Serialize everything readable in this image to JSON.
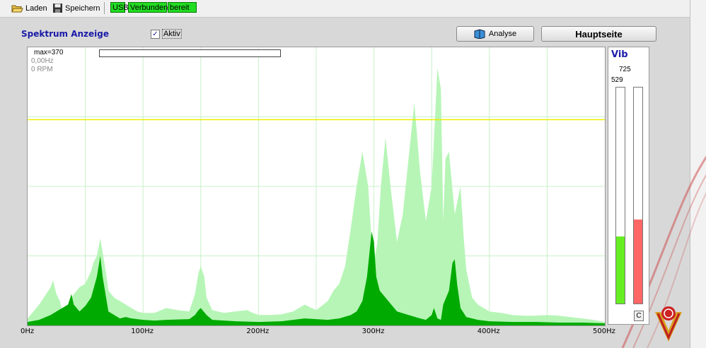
{
  "toolbar": {
    "load_label": "Laden",
    "save_label": "Speichern",
    "status": [
      "USB",
      "Verbunden",
      "bereit"
    ]
  },
  "spectrum": {
    "title": "Spektrum Anzeige",
    "active_label": "Aktiv",
    "active_checked": true,
    "max_label": "max=370",
    "freq_readout": "0,00Hz",
    "rpm_readout": "0 RPM"
  },
  "buttons": {
    "analyse_label": "Analyse",
    "home_label": "Hauptseite"
  },
  "vib": {
    "title": "Vib",
    "value_right": "725",
    "value_left": "529",
    "left_level": 0.31,
    "right_level": 0.39,
    "left_color": "#66ee22",
    "right_color": "#ff6666",
    "reset_label": "C"
  },
  "colors": {
    "title_blue": "#1a1aa8",
    "status_green": "#22dd22",
    "threshold_yellow": "#eeee00",
    "spectrum_light": "#b6f5b6",
    "spectrum_dark": "#00aa00",
    "grid": "#c8f0c8"
  },
  "chart_data": {
    "type": "area",
    "xlabel": "",
    "ylabel": "",
    "xlim": [
      0,
      500
    ],
    "ylim": [
      0,
      400
    ],
    "x_ticks": [
      "0Hz",
      "100Hz",
      "200Hz",
      "300Hz",
      "400Hz",
      "500Hz"
    ],
    "threshold": 296,
    "grid": true,
    "series": [
      {
        "x": [
          0,
          10,
          20,
          22,
          25,
          28,
          30,
          35,
          40,
          45,
          50,
          55,
          57,
          60,
          63,
          65,
          68,
          70,
          75,
          80,
          85,
          90,
          95,
          100,
          110,
          120,
          130,
          140,
          145,
          148,
          150,
          153,
          155,
          160,
          170,
          180,
          190,
          195,
          200,
          210,
          220,
          230,
          240,
          250,
          260,
          265,
          270,
          275,
          280,
          285,
          290,
          295,
          298,
          300,
          303,
          306,
          310,
          315,
          320,
          325,
          330,
          335,
          340,
          345,
          350,
          355,
          358,
          360,
          362,
          365,
          370,
          375,
          378,
          380,
          385,
          390,
          400,
          410,
          420,
          430,
          440,
          450,
          460,
          470,
          480,
          490,
          500
        ],
        "y": [
          10,
          30,
          55,
          65,
          45,
          35,
          20,
          30,
          45,
          55,
          60,
          78,
          90,
          100,
          125,
          105,
          75,
          50,
          40,
          35,
          30,
          25,
          20,
          18,
          18,
          25,
          22,
          20,
          45,
          75,
          85,
          70,
          40,
          22,
          18,
          20,
          22,
          18,
          15,
          15,
          16,
          20,
          30,
          22,
          35,
          50,
          60,
          85,
          140,
          200,
          250,
          200,
          120,
          90,
          120,
          200,
          270,
          190,
          120,
          160,
          240,
          320,
          220,
          150,
          200,
          370,
          340,
          150,
          240,
          250,
          160,
          200,
          120,
          80,
          40,
          30,
          20,
          18,
          15,
          14,
          14,
          15,
          14,
          12,
          10,
          8,
          5
        ]
      },
      {
        "x": [
          0,
          10,
          20,
          25,
          30,
          35,
          38,
          40,
          45,
          50,
          55,
          60,
          63,
          65,
          68,
          70,
          75,
          80,
          85,
          90,
          100,
          110,
          120,
          140,
          145,
          148,
          150,
          155,
          160,
          180,
          200,
          220,
          240,
          260,
          270,
          280,
          285,
          290,
          294,
          298,
          300,
          302,
          305,
          310,
          315,
          320,
          330,
          340,
          345,
          350,
          352,
          355,
          358,
          360,
          365,
          368,
          370,
          372,
          375,
          380,
          390,
          400,
          420,
          440,
          460,
          480,
          500
        ],
        "y": [
          5,
          8,
          15,
          20,
          25,
          30,
          45,
          30,
          20,
          28,
          40,
          70,
          100,
          70,
          40,
          20,
          15,
          10,
          12,
          10,
          8,
          7,
          8,
          9,
          15,
          22,
          25,
          15,
          8,
          6,
          5,
          6,
          10,
          8,
          10,
          15,
          20,
          35,
          70,
          135,
          120,
          70,
          50,
          40,
          30,
          20,
          15,
          10,
          8,
          15,
          25,
          10,
          8,
          30,
          50,
          90,
          95,
          60,
          25,
          12,
          8,
          6,
          5,
          5,
          4,
          4,
          3
        ]
      }
    ]
  },
  "app_logo": "vibration-logo"
}
